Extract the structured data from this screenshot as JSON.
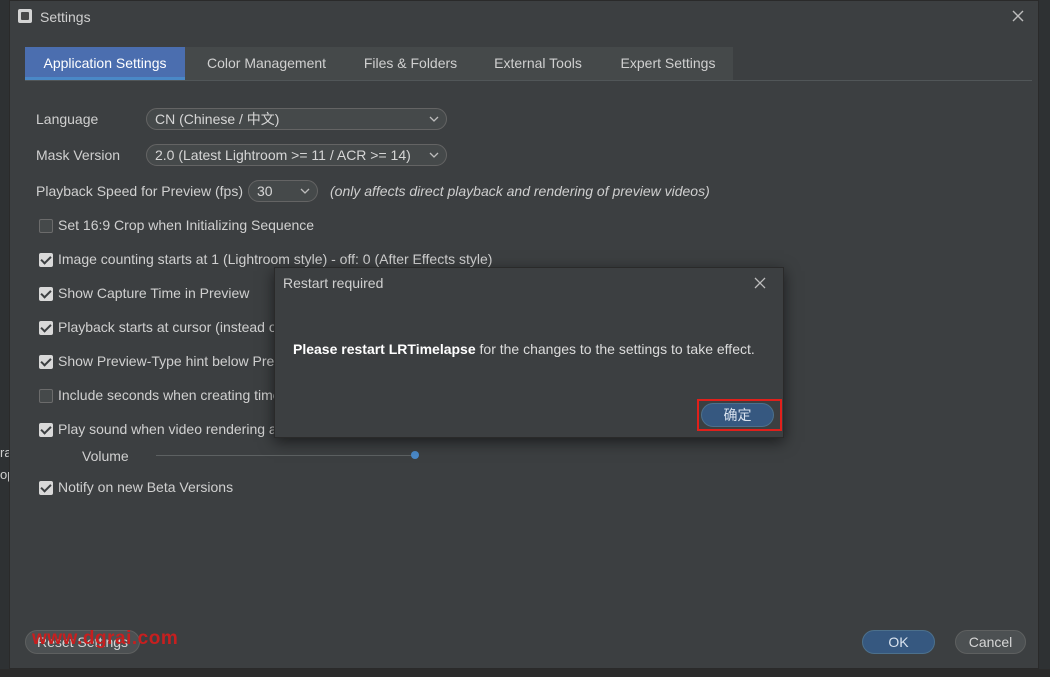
{
  "window": {
    "title": "Settings"
  },
  "background": {
    "left_fragment_1": "ra",
    "left_fragment_2": "op"
  },
  "tabs": [
    {
      "label": "Application Settings",
      "active": true
    },
    {
      "label": "Color Management"
    },
    {
      "label": "Files & Folders"
    },
    {
      "label": "External Tools"
    },
    {
      "label": "Expert Settings"
    }
  ],
  "settings": {
    "language": {
      "label": "Language",
      "value": "CN (Chinese / 中文)"
    },
    "mask_version": {
      "label": "Mask Version",
      "value": "2.0 (Latest Lightroom >= 11 / ACR >= 14)"
    },
    "playback_speed": {
      "label": "Playback Speed for Preview (fps)",
      "value": "30",
      "note": "(only affects direct playback and rendering of preview videos)"
    },
    "checkboxes": [
      {
        "label": "Set 16:9 Crop when Initializing Sequence",
        "checked": false
      },
      {
        "label": "Image counting starts at 1 (Lightroom style) - off: 0 (After Effects style)",
        "checked": true
      },
      {
        "label": "Show Capture Time in Preview",
        "checked": true
      },
      {
        "label": "Playback starts at cursor (instead o",
        "checked": true
      },
      {
        "label": "Show Preview-Type hint below Prev",
        "checked": true
      },
      {
        "label": "Include seconds when creating time",
        "checked": false
      },
      {
        "label": "Play sound when video rendering a",
        "checked": true
      }
    ],
    "volume": {
      "label": "Volume",
      "level": 1.0
    },
    "beta": {
      "label": "Notify on new Beta Versions",
      "checked": true
    }
  },
  "footer": {
    "reset_label": "Reset Settings",
    "ok_label": "OK",
    "cancel_label": "Cancel",
    "watermark": "www.dgrai.com"
  },
  "dialog": {
    "title": "Restart required",
    "message_bold": "Please restart LRTimelapse",
    "message_rest": " for the changes to the settings to take effect.",
    "ok_label": "确定"
  },
  "colors": {
    "accent": "#4b6eaf",
    "highlight_frame": "#e0201b",
    "watermark": "#c71f1f"
  }
}
